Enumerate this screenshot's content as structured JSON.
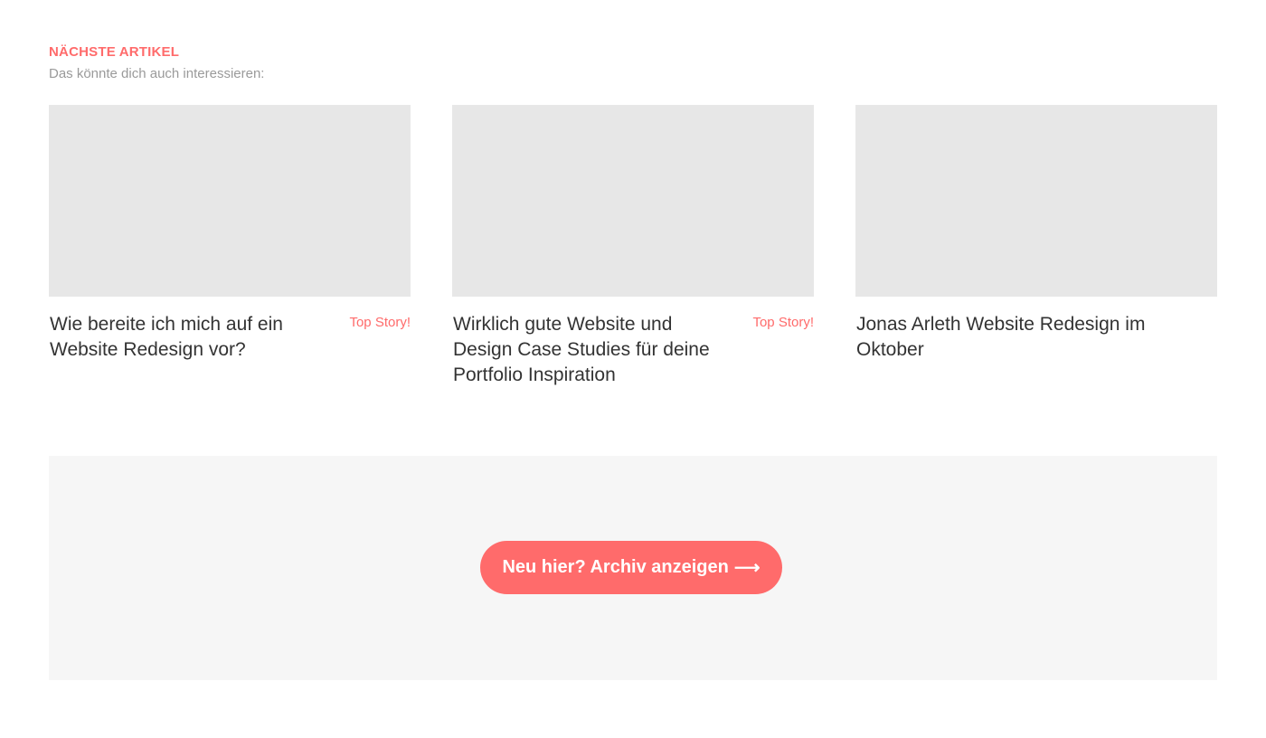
{
  "section": {
    "eyebrow": "NÄCHSTE ARTIKEL",
    "subtitle": "Das könnte dich auch interessieren:"
  },
  "articles": [
    {
      "title": "Wie bereite ich mich auf ein Website Redesign vor?",
      "badge": "Top Story!"
    },
    {
      "title": "Wirklich gute Website und Design Case Studies für deine Portfolio Inspiration",
      "badge": "Top Story!"
    },
    {
      "title": "Jonas Arleth Website Redesign im Oktober",
      "badge": ""
    }
  ],
  "cta": {
    "label": "Neu hier? Archiv anzeigen",
    "arrow": "⟶"
  },
  "colors": {
    "accent": "#ff6b6b",
    "thumbnail": "#e7e7e7",
    "panel": "#f6f6f6",
    "muted_text": "#9a9a9a",
    "body_text": "#333333"
  },
  "icons": {
    "cta_arrow": "arrow-right-icon"
  }
}
